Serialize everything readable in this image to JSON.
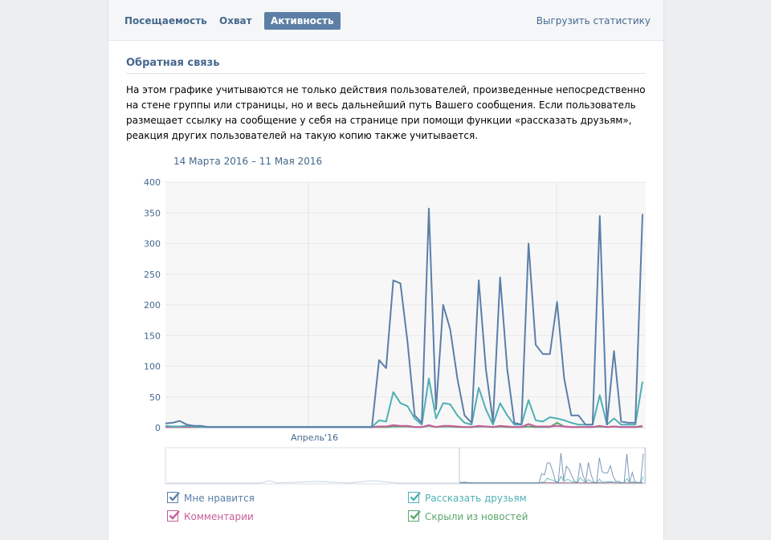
{
  "tabs": [
    {
      "label": "Посещаемость",
      "active": false
    },
    {
      "label": "Охват",
      "active": false
    },
    {
      "label": "Активность",
      "active": true
    }
  ],
  "export_label": "Выгрузить статистику",
  "section": {
    "title": "Обратная связь",
    "description": "На этом графике учитываются не только действия пользователей, произведенные непосредственно на стене группы или страницы, но и весь дальнейший путь Вашего сообщения. Если пользователь размещает ссылку на сообщение у себя на странице при помощи функции «рассказать друзьям», реакция других пользователей на такую копию также учитывается."
  },
  "date_range": "14 Марта 2016 – 11 Мая 2016",
  "legend": [
    {
      "label": "Мне нравится",
      "color": "#5b7fa8",
      "checked": true
    },
    {
      "label": "Рассказать друзьям",
      "color": "#4fb0b3",
      "checked": true
    },
    {
      "label": "Комментарии",
      "color": "#c65c9a",
      "checked": true
    },
    {
      "label": "Скрыли из новостей",
      "color": "#5aa66e",
      "checked": true
    }
  ],
  "chart_data": {
    "type": "line",
    "title": "",
    "xlabel": "",
    "ylabel": "",
    "ylim": [
      0,
      400
    ],
    "y_ticks": [
      0,
      50,
      100,
      150,
      200,
      250,
      300,
      350,
      400
    ],
    "x_range": [
      "2016-03-14",
      "2016-05-11"
    ],
    "x_tick_labels": [
      {
        "date": "2016-04-01",
        "label": "Апрель'16"
      }
    ],
    "grid": true,
    "legend_placement": "bottom",
    "series": [
      {
        "name": "Мне нравится",
        "color": "#5b7fa8",
        "values": [
          7,
          8,
          11,
          5,
          3,
          3,
          1,
          1,
          1,
          1,
          1,
          1,
          1,
          1,
          1,
          1,
          1,
          1,
          1,
          1,
          1,
          1,
          1,
          1,
          1,
          1,
          1,
          1,
          1,
          1,
          110,
          97,
          240,
          235,
          140,
          20,
          8,
          357,
          30,
          200,
          160,
          80,
          20,
          8,
          240,
          95,
          10,
          245,
          95,
          8,
          5,
          300,
          135,
          120,
          120,
          205,
          80,
          20,
          20,
          5,
          5,
          345,
          5,
          125,
          10,
          8,
          8,
          348
        ]
      },
      {
        "name": "Рассказать друзьям",
        "color": "#4fb0b3",
        "values": [
          3,
          2,
          2,
          3,
          2,
          1,
          1,
          1,
          1,
          1,
          1,
          1,
          1,
          1,
          1,
          1,
          1,
          1,
          1,
          1,
          1,
          1,
          1,
          1,
          1,
          1,
          1,
          1,
          1,
          1,
          12,
          10,
          58,
          40,
          35,
          15,
          5,
          80,
          15,
          40,
          38,
          20,
          8,
          5,
          65,
          30,
          5,
          40,
          20,
          5,
          5,
          45,
          12,
          10,
          17,
          15,
          12,
          8,
          5,
          5,
          5,
          53,
          5,
          15,
          5,
          5,
          5,
          75
        ]
      },
      {
        "name": "Комментарии",
        "color": "#c65c9a",
        "values": [
          1,
          1,
          1,
          1,
          1,
          1,
          1,
          1,
          1,
          1,
          1,
          1,
          1,
          1,
          1,
          1,
          1,
          1,
          1,
          1,
          1,
          1,
          1,
          1,
          1,
          1,
          1,
          1,
          1,
          1,
          2,
          2,
          4,
          3,
          3,
          1,
          1,
          4,
          1,
          3,
          3,
          2,
          1,
          1,
          3,
          2,
          1,
          3,
          2,
          1,
          1,
          6,
          2,
          2,
          2,
          3,
          2,
          1,
          1,
          1,
          1,
          3,
          1,
          2,
          1,
          1,
          1,
          3
        ]
      },
      {
        "name": "Скрыли из новостей",
        "color": "#5aa66e",
        "values": [
          1,
          1,
          1,
          1,
          1,
          1,
          1,
          1,
          1,
          1,
          1,
          1,
          1,
          1,
          1,
          1,
          1,
          1,
          1,
          1,
          1,
          1,
          1,
          1,
          1,
          1,
          1,
          1,
          1,
          1,
          1,
          1,
          2,
          2,
          2,
          1,
          1,
          3,
          1,
          2,
          2,
          1,
          1,
          1,
          2,
          2,
          1,
          2,
          1,
          1,
          1,
          2,
          1,
          1,
          1,
          8,
          2,
          1,
          1,
          1,
          1,
          2,
          1,
          2,
          1,
          1,
          1,
          2
        ]
      }
    ]
  }
}
